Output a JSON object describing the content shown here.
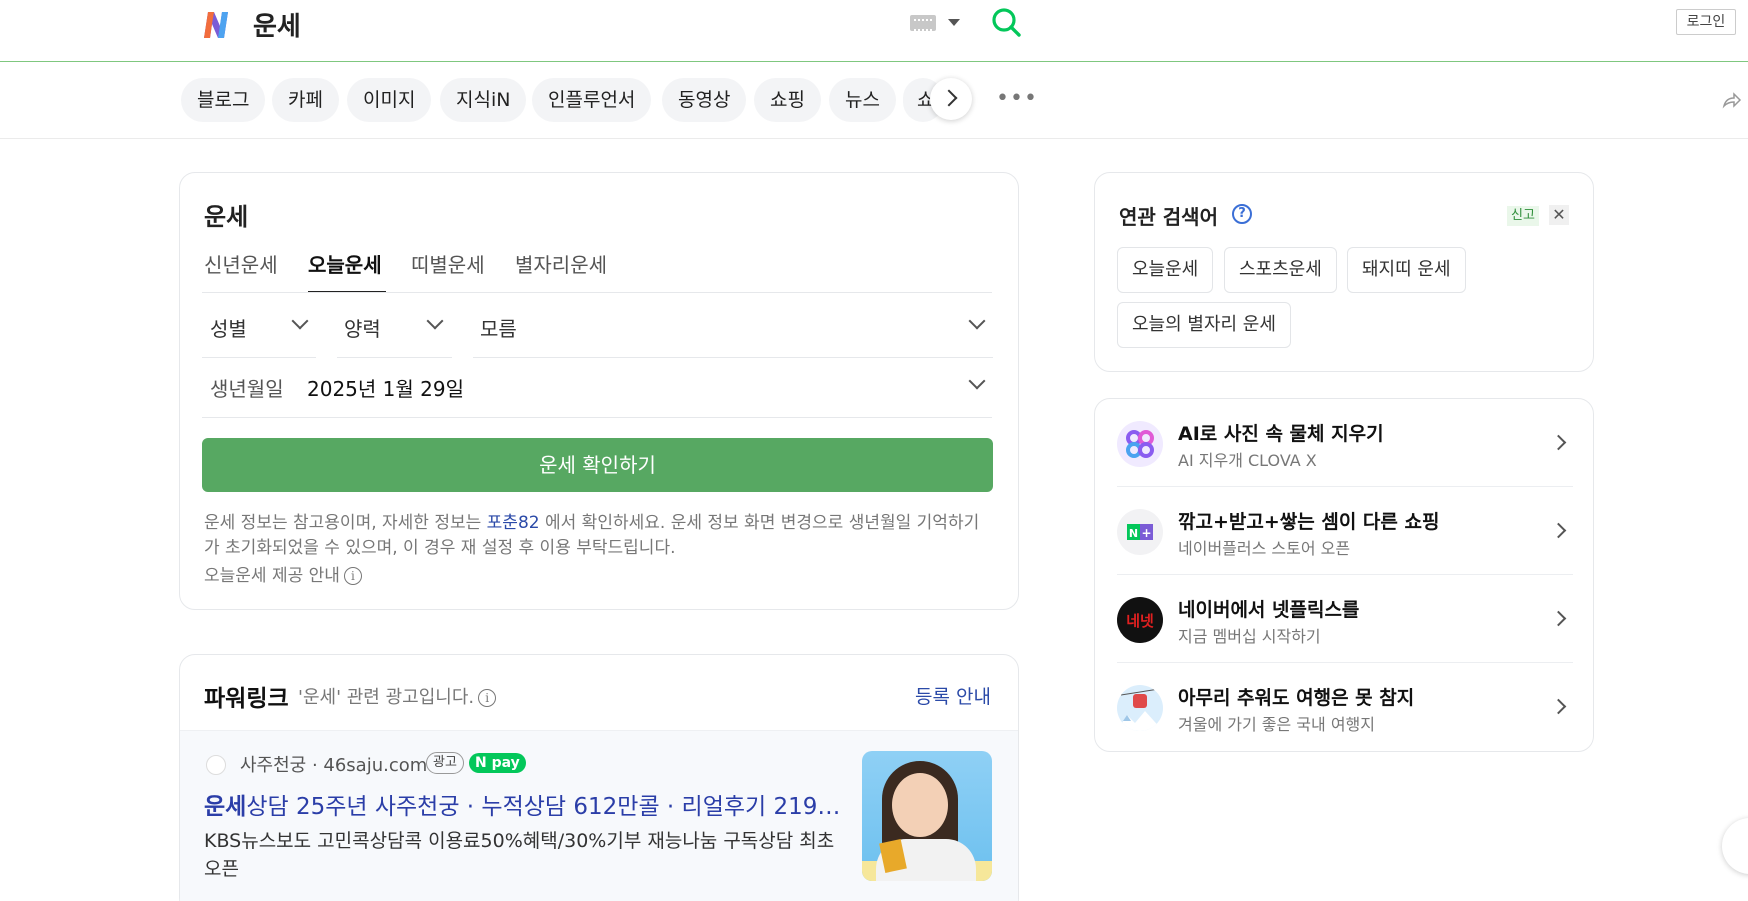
{
  "header": {
    "query": "운세",
    "login_label": "로그인"
  },
  "tabs": [
    "블로그",
    "카페",
    "이미지",
    "지식iN",
    "인플루언서",
    "동영상",
    "쇼핑",
    "뉴스",
    "쇼"
  ],
  "fortune": {
    "title": "운세",
    "sub_tabs": [
      "신년운세",
      "오늘운세",
      "띠별운세",
      "별자리운세"
    ],
    "active_sub_tab": "오늘운세",
    "gender_select": "성별",
    "calendar_select": "양력",
    "time_select": "모름",
    "birth_label": "생년월일",
    "birth_value": "2025년 1월 29일",
    "confirm_label": "운세 확인하기",
    "notice_part1": "운세 정보는 참고용이며, 자세한 정보는 ",
    "notice_link": "포춘82",
    "notice_part2": " 에서 확인하세요. 운세 정보 화면 변경으로 생년월일 기억하기가 초기화되었을 수 있으며, 이 경우 재 설정 후 이용 부탁드립니다.",
    "provider_label": "오늘운세 제공 안내"
  },
  "power_link": {
    "title": "파워링크",
    "desc": "'운세' 관련 광고입니다.",
    "register_label": "등록 안내",
    "ad": {
      "site": "사주천궁 · 46saju.com",
      "badge": "광고",
      "pay": "N pay",
      "title_highlight": "운세",
      "title_rest": "상담 25주년 사주천궁 · 누적상담 612만콜 · 리얼후기 219만...",
      "text": "KBS뉴스보도 고민콕상담콕 이용료50%혜택/30%기부 재능나눔 구독상담 최초 오픈"
    }
  },
  "related": {
    "title": "연관 검색어",
    "report_label": "신고",
    "chips": [
      "오늘운세",
      "스포츠운세",
      "돼지띠 운세",
      "오늘의 별자리 운세"
    ]
  },
  "promos": [
    {
      "title": "AI로 사진 속 물체 지우기",
      "sub": "AI 지우개 CLOVA X",
      "icon": "clova-icon"
    },
    {
      "title": "깎고+받고+쌓는 셈이 다른 쇼핑",
      "sub": "네이버플러스 스토어 오픈",
      "icon": "naver-plus-icon"
    },
    {
      "title": "네이버에서 넷플릭스를",
      "sub": "지금 멤버십 시작하기",
      "icon": "netflix-icon",
      "icon_text": "네넷"
    },
    {
      "title": "아무리 추워도 여행은 못 참지",
      "sub": "겨울에 가기 좋은 국내 여행지",
      "icon": "travel-icon"
    }
  ],
  "colors": {
    "accent_green": "#57a862",
    "link_blue": "#2b4aa8"
  }
}
